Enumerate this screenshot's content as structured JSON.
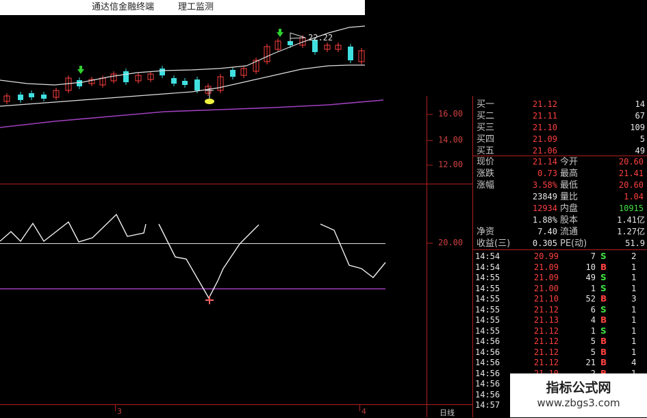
{
  "titlebar": {
    "app_name": "通达信金融终端",
    "module": "理工监测"
  },
  "price_axis": [
    "16.00",
    "14.00",
    "12.00"
  ],
  "indicator_axis": [
    "20.00"
  ],
  "candle_annotation": "22.22",
  "x_axis": {
    "ticks": [
      "3",
      "4"
    ],
    "period_label": "日线"
  },
  "order_book": [
    {
      "label": "买一",
      "price": "21.12",
      "volume": "14"
    },
    {
      "label": "买二",
      "price": "21.11",
      "volume": "67"
    },
    {
      "label": "买三",
      "price": "21.10",
      "volume": "109"
    },
    {
      "label": "买四",
      "price": "21.09",
      "volume": "5"
    },
    {
      "label": "买五",
      "price": "21.06",
      "volume": "49"
    }
  ],
  "stats": {
    "current_label": "现价",
    "current": "21.14",
    "open_label": "今开",
    "open": "20.60",
    "change_label": "涨跌",
    "change": "0.73",
    "high_label": "最高",
    "high": "21.41",
    "pct_label": "涨幅",
    "pct": "3.58%",
    "low_label": "最低",
    "low": "20.60",
    "volume": "23849",
    "ratio_label": "量比",
    "ratio": "1.04",
    "outer": "12934",
    "inner_label": "内盘",
    "inner": "10915",
    "turnover": "1.88%",
    "shares_label": "股本",
    "shares": "1.41亿",
    "netasset_label": "净资",
    "netasset": "7.40",
    "float_label": "流通",
    "float": "1.27亿",
    "eps_label": "收益(三)",
    "eps": "0.305",
    "pe_label": "PE(动)",
    "pe": "51.9"
  },
  "ticks": [
    {
      "time": "14:54",
      "price": "20.99",
      "vol": "7",
      "dir": "S",
      "n": "2"
    },
    {
      "time": "14:54",
      "price": "21.09",
      "vol": "10",
      "dir": "B",
      "n": "1"
    },
    {
      "time": "14:55",
      "price": "21.09",
      "vol": "49",
      "dir": "S",
      "n": "1"
    },
    {
      "time": "14:55",
      "price": "21.00",
      "vol": "1",
      "dir": "S",
      "n": "1"
    },
    {
      "time": "14:55",
      "price": "21.10",
      "vol": "52",
      "dir": "B",
      "n": "3"
    },
    {
      "time": "14:55",
      "price": "21.12",
      "vol": "6",
      "dir": "S",
      "n": "1"
    },
    {
      "time": "14:55",
      "price": "21.13",
      "vol": "4",
      "dir": "B",
      "n": "1"
    },
    {
      "time": "14:55",
      "price": "21.12",
      "vol": "1",
      "dir": "S",
      "n": "1"
    },
    {
      "time": "14:56",
      "price": "21.12",
      "vol": "5",
      "dir": "B",
      "n": "1"
    },
    {
      "time": "14:56",
      "price": "21.12",
      "vol": "5",
      "dir": "B",
      "n": "1"
    },
    {
      "time": "14:56",
      "price": "21.12",
      "vol": "21",
      "dir": "B",
      "n": "4"
    },
    {
      "time": "14:56",
      "price": "21.10",
      "vol": "2",
      "dir": "B",
      "n": "1"
    },
    {
      "time": "14:56",
      "price": "",
      "vol": "",
      "dir": "",
      "n": ""
    },
    {
      "time": "14:56",
      "price": "",
      "vol": "",
      "dir": "",
      "n": ""
    },
    {
      "time": "14:57",
      "price": "",
      "vol": "",
      "dir": "",
      "n": ""
    }
  ],
  "watermark": {
    "title": "指标公式网",
    "url": "www.zbgs3.com"
  },
  "colors": {
    "up": "#ff4040",
    "down": "#40e0e0",
    "grid": "#b02020",
    "ma_white": "#e0e0e0",
    "ma_purple": "#a040c0",
    "signal_green": "#30d030",
    "signal_yellow": "#f0f040"
  }
}
